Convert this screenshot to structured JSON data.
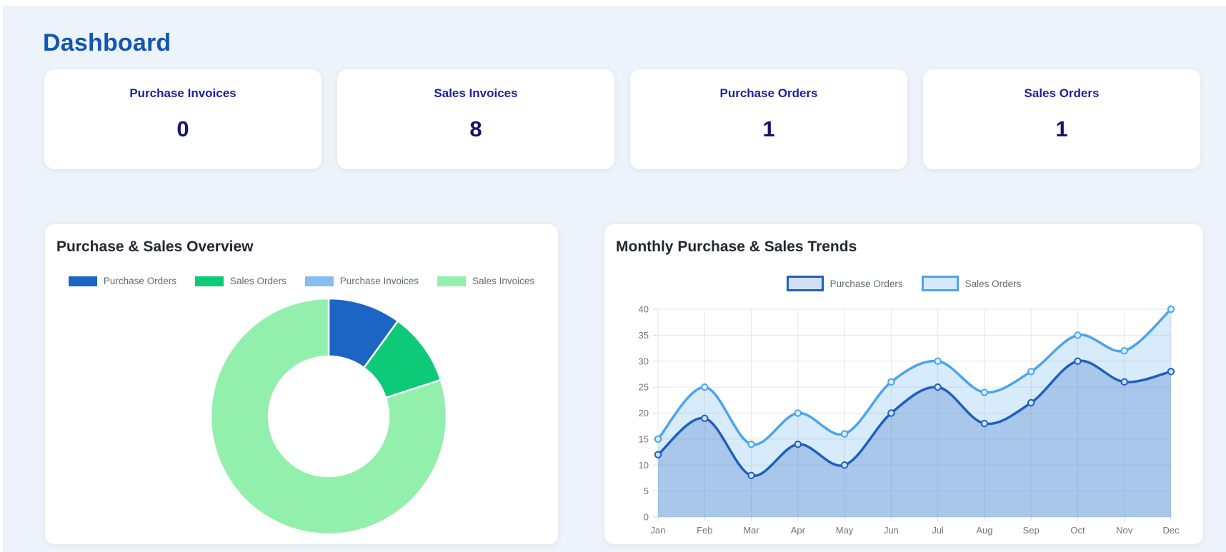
{
  "page": {
    "title": "Dashboard",
    "background": "#edf3fb",
    "title_color": "#1256b4"
  },
  "stats": [
    {
      "label": "Purchase Invoices",
      "value": "0"
    },
    {
      "label": "Sales Invoices",
      "value": "8"
    },
    {
      "label": "Purchase Orders",
      "value": "1"
    },
    {
      "label": "Sales Orders",
      "value": "1"
    }
  ],
  "colors": {
    "stat_title": "#1c1ea9",
    "stat_value": "#15156d",
    "legend_text": "#666a70",
    "axis_text": "#757575",
    "gridline": "#e6e6e6"
  },
  "overview_card": {
    "title": "Purchase & Sales Overview"
  },
  "trends_card": {
    "title": "Monthly Purchase & Sales Trends"
  },
  "chart_data": [
    {
      "type": "pie",
      "variant": "doughnut",
      "title": "Purchase & Sales Overview",
      "labels": [
        "Purchase Orders",
        "Sales Orders",
        "Purchase Invoices",
        "Sales Invoices"
      ],
      "values": [
        1,
        1,
        0,
        8
      ],
      "colors": [
        "#1c65c5",
        "#0cca78",
        "#86bdf2",
        "#92efac"
      ],
      "cutout_ratio": 0.51,
      "legend_position": "top",
      "slice_border_color": "#ffffff"
    },
    {
      "type": "line",
      "title": "Monthly Purchase & Sales Trends",
      "categories": [
        "Jan",
        "Feb",
        "Mar",
        "Apr",
        "May",
        "Jun",
        "Jul",
        "Aug",
        "Sep",
        "Oct",
        "Nov",
        "Dec"
      ],
      "series": [
        {
          "name": "Purchase Orders",
          "values": [
            12,
            19,
            8,
            14,
            10,
            20,
            25,
            18,
            22,
            30,
            26,
            28
          ],
          "line_color": "#1f60bd",
          "fill_color": "rgba(30,95,190,0.26)",
          "point_fill": "#cfdff3",
          "legend_fill": "#d2dff2"
        },
        {
          "name": "Sales Orders",
          "values": [
            15,
            25,
            14,
            20,
            16,
            26,
            30,
            24,
            28,
            35,
            32,
            40
          ],
          "line_color": "#4ba4ee",
          "fill_color": "rgba(77,163,238,0.22)",
          "point_fill": "#ddeefb",
          "legend_fill": "#d7e9fb"
        }
      ],
      "xlabel": "",
      "ylabel": "",
      "ylim": [
        0,
        40
      ],
      "ytick_step": 5,
      "grid": true,
      "area_fill": true,
      "smooth": true,
      "legend_position": "top"
    }
  ]
}
